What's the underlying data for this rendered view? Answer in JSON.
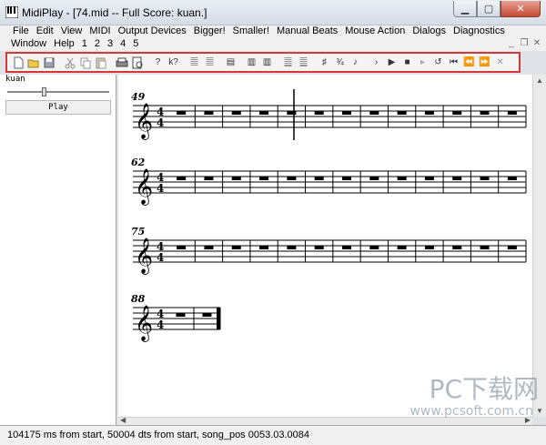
{
  "window": {
    "title": "MidiPlay - [74.mid -- Full Score: kuan.]"
  },
  "menu": {
    "row1": [
      "File",
      "Edit",
      "View",
      "MIDI",
      "Output Devices",
      "Bigger!",
      "Smaller!",
      "Manual Beats",
      "Mouse Action",
      "Dialogs",
      "Diagnostics"
    ],
    "row2": [
      "Window",
      "Help",
      "1",
      "2",
      "3",
      "4",
      "5"
    ]
  },
  "left_panel": {
    "track_name": "kuan",
    "play_label": "Play"
  },
  "score": {
    "measure_numbers": [
      "49",
      "62",
      "75",
      "88"
    ]
  },
  "status": {
    "text": "104175 ms from start, 50004 dts from start, song_pos 0053.03.0084"
  },
  "watermark": {
    "main": "PC下载网",
    "url": "www.pcsoft.com.cn"
  },
  "icons": [
    "new-icon",
    "open-icon",
    "save-icon",
    "cut-icon",
    "copy-icon",
    "paste-icon",
    "print-icon",
    "print-preview-icon",
    "help-icon",
    "context-help-icon"
  ]
}
